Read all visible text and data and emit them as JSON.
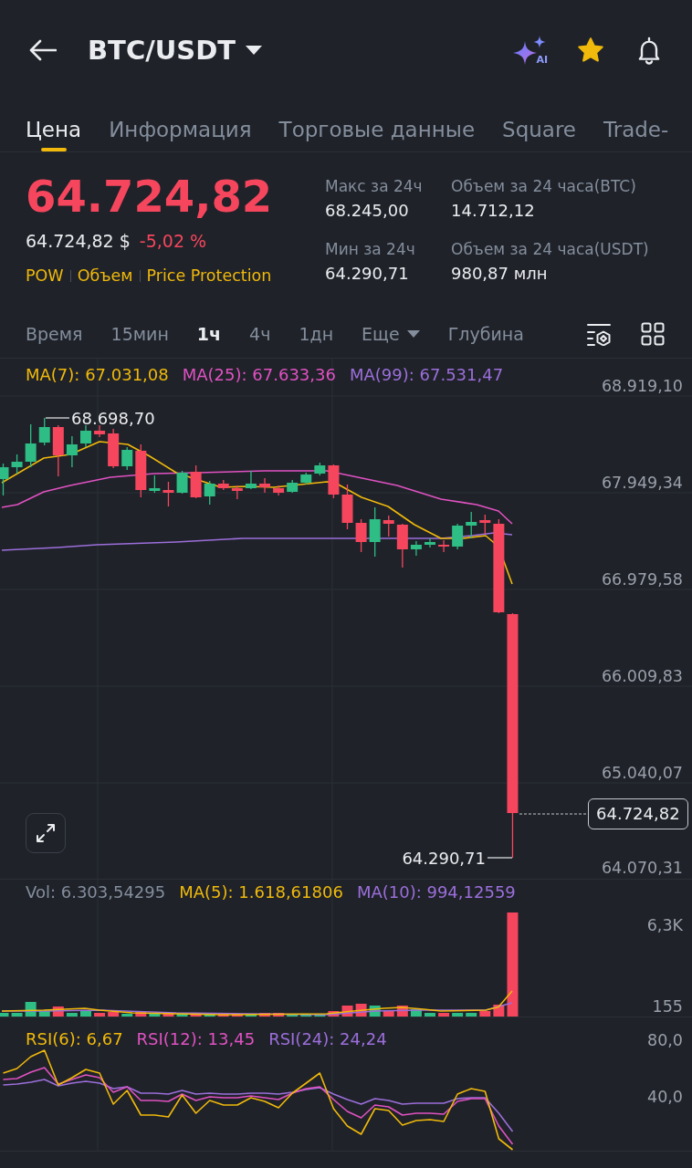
{
  "header": {
    "title": "BTC/USDT",
    "ai_label": "AI",
    "favorite": true
  },
  "tabs": [
    {
      "label": "Цена",
      "selected": true
    },
    {
      "label": "Информация",
      "selected": false
    },
    {
      "label": "Торговые данные",
      "selected": false
    },
    {
      "label": "Square",
      "selected": false
    },
    {
      "label": "Trade-",
      "selected": false
    }
  ],
  "ticker": {
    "last_price": "64.724,82",
    "negative": true,
    "usd_price": "64.724,82 $",
    "change": "-5,02 %",
    "tags": [
      "POW",
      "Объем",
      "Price Protection"
    ]
  },
  "stats": [
    {
      "label": "Макс за 24ч",
      "value": "68.245,00"
    },
    {
      "label": "Объем за 24 часа(BTC)",
      "value": "14.712,12"
    },
    {
      "label": "Мин за 24ч",
      "value": "64.290,71"
    },
    {
      "label": "Объем за 24 часа(USDT)",
      "value": "980,87 млн"
    }
  ],
  "intervals": [
    {
      "label": "Время",
      "kind": "option",
      "selected": false
    },
    {
      "label": "15мин",
      "kind": "option",
      "selected": false
    },
    {
      "label": "1ч",
      "kind": "option",
      "selected": true
    },
    {
      "label": "4ч",
      "kind": "option",
      "selected": false
    },
    {
      "label": "1дн",
      "kind": "option",
      "selected": false
    },
    {
      "label": "Еще",
      "kind": "dropdown",
      "selected": false
    },
    {
      "label": "Глубина",
      "kind": "option",
      "selected": false
    }
  ],
  "price_chart": {
    "legend": [
      {
        "label": "MA(7): 67.031,08",
        "color": "#f0b90b"
      },
      {
        "label": "MA(25): 67.633,36",
        "color": "#e052c2"
      },
      {
        "label": "MA(99): 67.531,47",
        "color": "#9c6fdb"
      }
    ],
    "axis_labels": [
      "68.919,10",
      "67.949,34",
      "66.979,58",
      "66.009,83",
      "65.040,07",
      "64.070,31"
    ],
    "high_label": "68.698,70",
    "low_label": "64.290,71",
    "current_price": "64.724,82"
  },
  "volume_chart": {
    "legend": [
      {
        "label": "Vol: 6.303,54295",
        "color": "#848e9c"
      },
      {
        "label": "MA(5): 1.618,61806",
        "color": "#f0b90b"
      },
      {
        "label": "MA(10): 994,12559",
        "color": "#9c6fdb"
      }
    ],
    "axis_labels": [
      "6,3K",
      "155"
    ]
  },
  "rsi_chart": {
    "legend": [
      {
        "label": "RSI(6): 6,67",
        "color": "#f0b90b"
      },
      {
        "label": "RSI(12): 13,45",
        "color": "#e052c2"
      },
      {
        "label": "RSI(24): 24,24",
        "color": "#9c6fdb"
      }
    ],
    "axis_labels": [
      "80,0",
      "40,0"
    ]
  }
}
